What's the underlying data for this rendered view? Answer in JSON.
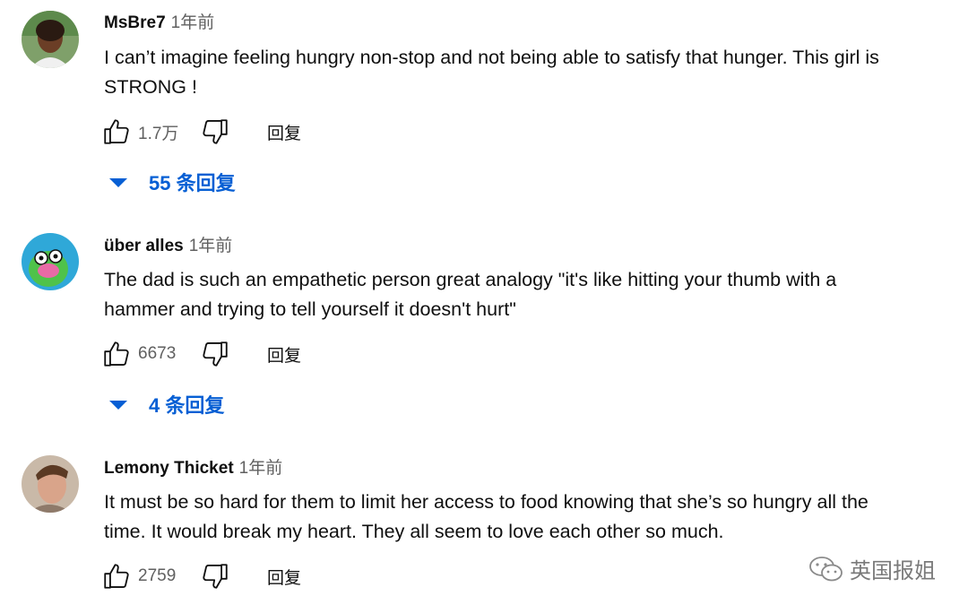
{
  "comments": [
    {
      "author": "MsBre7",
      "time": "1年前",
      "text": "I can’t imagine feeling hungry non-stop and not being able to satisfy that hunger. This girl is STRONG !",
      "likes": "1.7万",
      "reply_label": "回复",
      "replies_label": "55 条回复"
    },
    {
      "author": "über alles",
      "time": "1年前",
      "text": "The dad is such an empathetic person great analogy \"it's like hitting your thumb with a hammer and trying to tell yourself it doesn't hurt\"",
      "likes": "6673",
      "reply_label": "回复",
      "replies_label": "4 条回复"
    },
    {
      "author": "Lemony Thicket",
      "time": "1年前",
      "text": "It must be so hard for them to limit her access to food knowing that she’s so hungry all the time. It would break my heart. They all seem to love each other so much.",
      "likes": "2759",
      "reply_label": "回复"
    }
  ],
  "watermark": "英国报姐",
  "colors": {
    "link": "#065fd4",
    "muted": "#606060",
    "text": "#0f0f0f"
  }
}
